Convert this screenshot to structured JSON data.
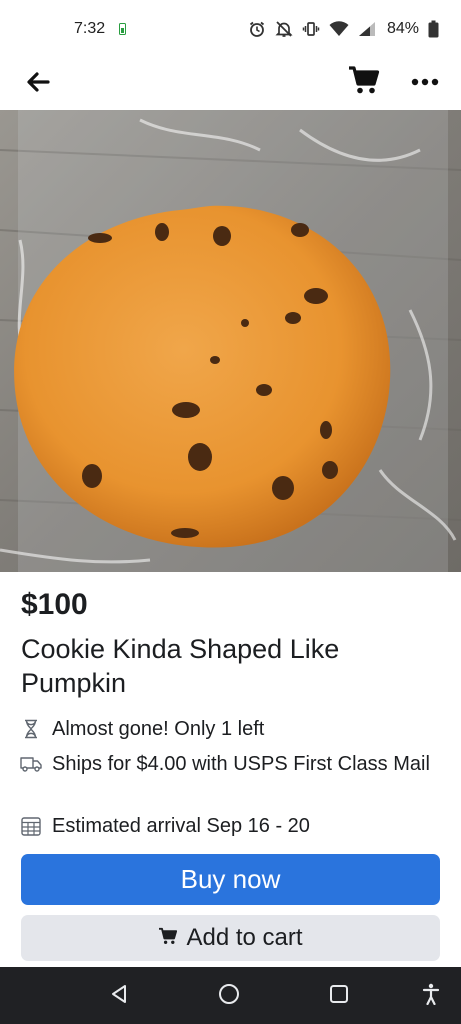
{
  "status_bar": {
    "time": "7:32",
    "battery_percent": "84%",
    "icons": [
      "battery-charging-icon",
      "alarm-icon",
      "mute-icon",
      "vibrate-icon",
      "wifi-icon",
      "signal-icon",
      "battery-icon"
    ]
  },
  "header": {
    "back_icon": "arrow-left-icon",
    "cart_icon": "cart-icon",
    "more_icon": "more-horizontal-icon"
  },
  "listing": {
    "image_alt": "cookie-photo",
    "price": "$100",
    "title": "Cookie Kinda Shaped Like Pumpkin",
    "details": [
      {
        "icon": "hourglass-icon",
        "text": "Almost gone! Only 1 left"
      },
      {
        "icon": "truck-icon",
        "text": "Ships for $4.00 with USPS First Class Mail"
      },
      {
        "icon": "calendar-icon",
        "text": "Estimated arrival Sep 16 - 20"
      }
    ]
  },
  "actions": {
    "buy_now": "Buy now",
    "add_to_cart": "Add to cart"
  },
  "nav_bar": {
    "icons": [
      "back-triangle-icon",
      "home-circle-icon",
      "recents-square-icon",
      "accessibility-icon"
    ]
  },
  "colors": {
    "primary": "#2a74dd",
    "secondary_button": "#e4e6eb",
    "text": "#1c1e21",
    "nav_bar": "#202124"
  }
}
